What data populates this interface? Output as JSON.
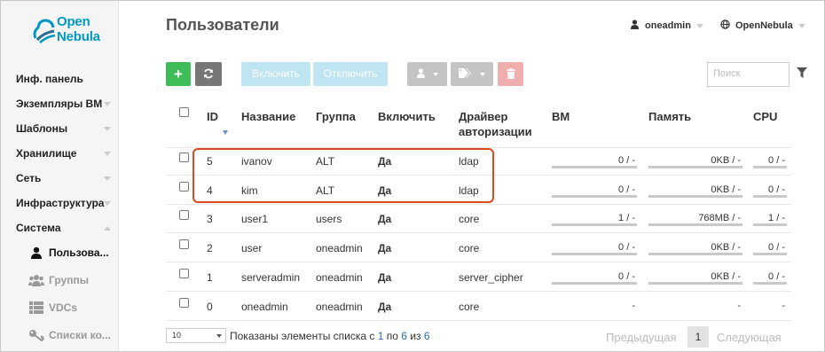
{
  "app": {
    "logo_text_1": "Open",
    "logo_text_2": "Nebula",
    "brand_color": "#0098c3"
  },
  "sidebar": {
    "items": [
      {
        "label": "Инф. панель",
        "chevron": false
      },
      {
        "label": "Экземпляры ВМ",
        "chevron": true
      },
      {
        "label": "Шаблоны",
        "chevron": true
      },
      {
        "label": "Хранилище",
        "chevron": true
      },
      {
        "label": "Сеть",
        "chevron": true
      },
      {
        "label": "Инфраструктура",
        "chevron": true
      },
      {
        "label": "Система",
        "chevron": true
      }
    ],
    "subitems": [
      {
        "label": "Пользова...",
        "icon": "user-icon",
        "active": true
      },
      {
        "label": "Группы",
        "icon": "users-icon",
        "active": false
      },
      {
        "label": "VDCs",
        "icon": "grid-icon",
        "active": false
      },
      {
        "label": "Списки ко...",
        "icon": "key-icon",
        "active": false
      }
    ]
  },
  "header": {
    "title": "Пользователи",
    "user": "oneadmin",
    "zone": "OpenNebula"
  },
  "toolbar": {
    "add_label": "+",
    "enable_label": "Включить",
    "disable_label": "Отключить",
    "search_placeholder": "Поиск"
  },
  "table": {
    "columns": {
      "id": "ID",
      "name": "Название",
      "group": "Группа",
      "enabled": "Включить",
      "auth_1": "Драйвер",
      "auth_2": "авторизации",
      "vm": "ВМ",
      "memory": "Память",
      "cpu": "CPU"
    },
    "rows": [
      {
        "id": "5",
        "name": "ivanov",
        "group": "ALT",
        "enabled": "Да",
        "auth": "ldap",
        "vm": "0 / -",
        "memory": "0KB / -",
        "cpu": "0 / -"
      },
      {
        "id": "4",
        "name": "kim",
        "group": "ALT",
        "enabled": "Да",
        "auth": "ldap",
        "vm": "0 / -",
        "memory": "0KB / -",
        "cpu": "0 / -"
      },
      {
        "id": "3",
        "name": "user1",
        "group": "users",
        "enabled": "Да",
        "auth": "core",
        "vm": "1 / -",
        "memory": "768MB / -",
        "cpu": "1 / -"
      },
      {
        "id": "2",
        "name": "user",
        "group": "oneadmin",
        "enabled": "Да",
        "auth": "core",
        "vm": "0 / -",
        "memory": "0KB / -",
        "cpu": "0 / -"
      },
      {
        "id": "1",
        "name": "serveradmin",
        "group": "oneadmin",
        "enabled": "Да",
        "auth": "server_cipher",
        "vm": "0 / -",
        "memory": "0KB / -",
        "cpu": "0 / -"
      },
      {
        "id": "0",
        "name": "oneadmin",
        "group": "oneadmin",
        "enabled": "Да",
        "auth": "core",
        "vm": "-",
        "memory": "-",
        "cpu": "-"
      }
    ]
  },
  "footer": {
    "page_length": "10",
    "info_prefix": "Показаны элементы списка с",
    "info_from": "1",
    "info_mid1": "по",
    "info_to": "6",
    "info_mid2": "из",
    "info_total": "6",
    "prev": "Предыдущая",
    "current": "1",
    "next": "Следующая"
  },
  "colors": {
    "add": "#3dbc58",
    "refresh": "#777777",
    "highlight": "#d84a20",
    "enable": "#bfe4f2",
    "delete": "#f0aeae"
  }
}
